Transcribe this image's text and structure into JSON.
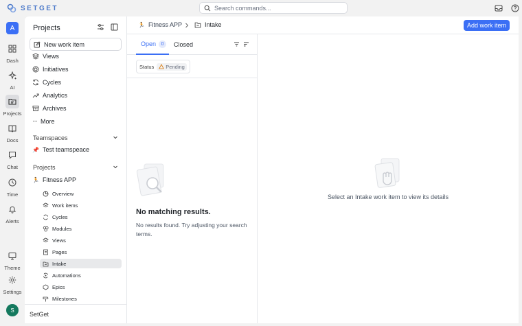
{
  "app": {
    "name": "SETGET",
    "brand_color": "#3b6ff5"
  },
  "search": {
    "placeholder": "Search commands..."
  },
  "rail": {
    "workspace_initial": "A",
    "items": [
      {
        "label": "Dash",
        "icon": "dashboard-icon"
      },
      {
        "label": "AI",
        "icon": "sparkle-icon"
      },
      {
        "label": "Projects",
        "icon": "folder-icon",
        "active": true
      },
      {
        "label": "Docs",
        "icon": "book-icon"
      },
      {
        "label": "Chat",
        "icon": "chat-icon"
      },
      {
        "label": "Time",
        "icon": "clock-icon"
      },
      {
        "label": "Alerts",
        "icon": "bell-icon"
      },
      {
        "label": "Theme",
        "icon": "monitor-icon"
      },
      {
        "label": "Settings",
        "icon": "gear-icon"
      }
    ],
    "user_initial": "S"
  },
  "sidebar": {
    "title": "Projects",
    "new_item_label": "New work item",
    "nav": [
      "Views",
      "Initiatives",
      "Cycles",
      "Analytics",
      "Archives",
      "More"
    ],
    "teamspaces_label": "Teamspaces",
    "teamspace": {
      "emoji": "📌",
      "name": "Test teamspeace"
    },
    "projects_label": "Projects",
    "project": {
      "emoji": "🏃",
      "name": "Fitness APP"
    },
    "sub_items": [
      "Overview",
      "Work items",
      "Cycles",
      "Modules",
      "Views",
      "Pages",
      "Intake",
      "Automations",
      "Epics",
      "Milestones"
    ],
    "active_sub": "Intake",
    "footer_workspace": "SetGet"
  },
  "header": {
    "project_emoji": "🏃",
    "project_name": "Fitness APP",
    "page_name": "Intake",
    "add_button_label": "Add work item"
  },
  "tabs": {
    "open_label": "Open",
    "open_count": "0",
    "closed_label": "Closed"
  },
  "filter": {
    "label": "Status",
    "value": "Pending"
  },
  "empty": {
    "title": "No matching results.",
    "description": "No results found. Try adjusting your search terms."
  },
  "detail": {
    "message": "Select an Intake work item to view its details"
  }
}
